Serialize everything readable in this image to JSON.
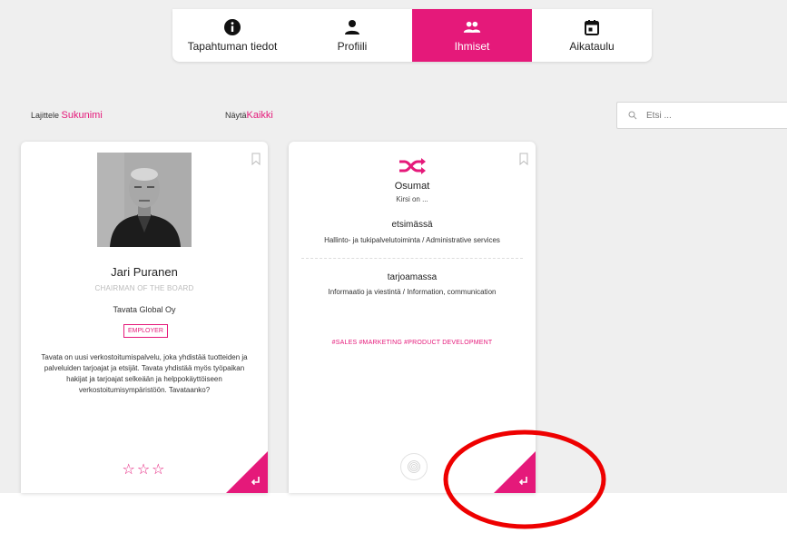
{
  "tabs": [
    {
      "label": "Tapahtuman tiedot",
      "icon": "info-icon",
      "active": false
    },
    {
      "label": "Profiili",
      "icon": "person-icon",
      "active": false
    },
    {
      "label": "Ihmiset",
      "icon": "people-icon",
      "active": true
    },
    {
      "label": "Aikataulu",
      "icon": "calendar-icon",
      "active": false
    }
  ],
  "sort": {
    "label": "Lajittele",
    "value": "Sukunimi"
  },
  "show": {
    "label": "Näytä",
    "value": "Kaikki"
  },
  "search": {
    "placeholder": "Etsi ...",
    "value": ""
  },
  "person_card": {
    "name": "Jari Puranen",
    "title": "CHAIRMAN OF THE BOARD",
    "company": "Tavata Global Oy",
    "badge": "EMPLOYER",
    "description": "Tavata on uusi verkostoitumispalvelu, joka yhdistää tuotteiden ja palveluiden tarjoajat ja etsijät. Tavata yhdistää myös työpaikan hakijat ja tarjoajat selkeään ja helppokäyttöiseen verkostoitumisympäristöön. Tavataanko?",
    "rating": "☆☆☆"
  },
  "match_card": {
    "title": "Osumat",
    "subtitle": "Kirsi on ...",
    "seeking_label": "etsimässä",
    "seeking_value": "Hallinto- ja tukipalvelutoiminta / Administrative services",
    "offering_label": "tarjoamassa",
    "offering_value": "Informaatio ja viestintä / Information, communication",
    "tags": "#SALES #MARKETING #PRODUCT DEVELOPMENT"
  },
  "colors": {
    "accent": "#e5197a",
    "annotation": "#ee0000",
    "background": "#efefef"
  }
}
